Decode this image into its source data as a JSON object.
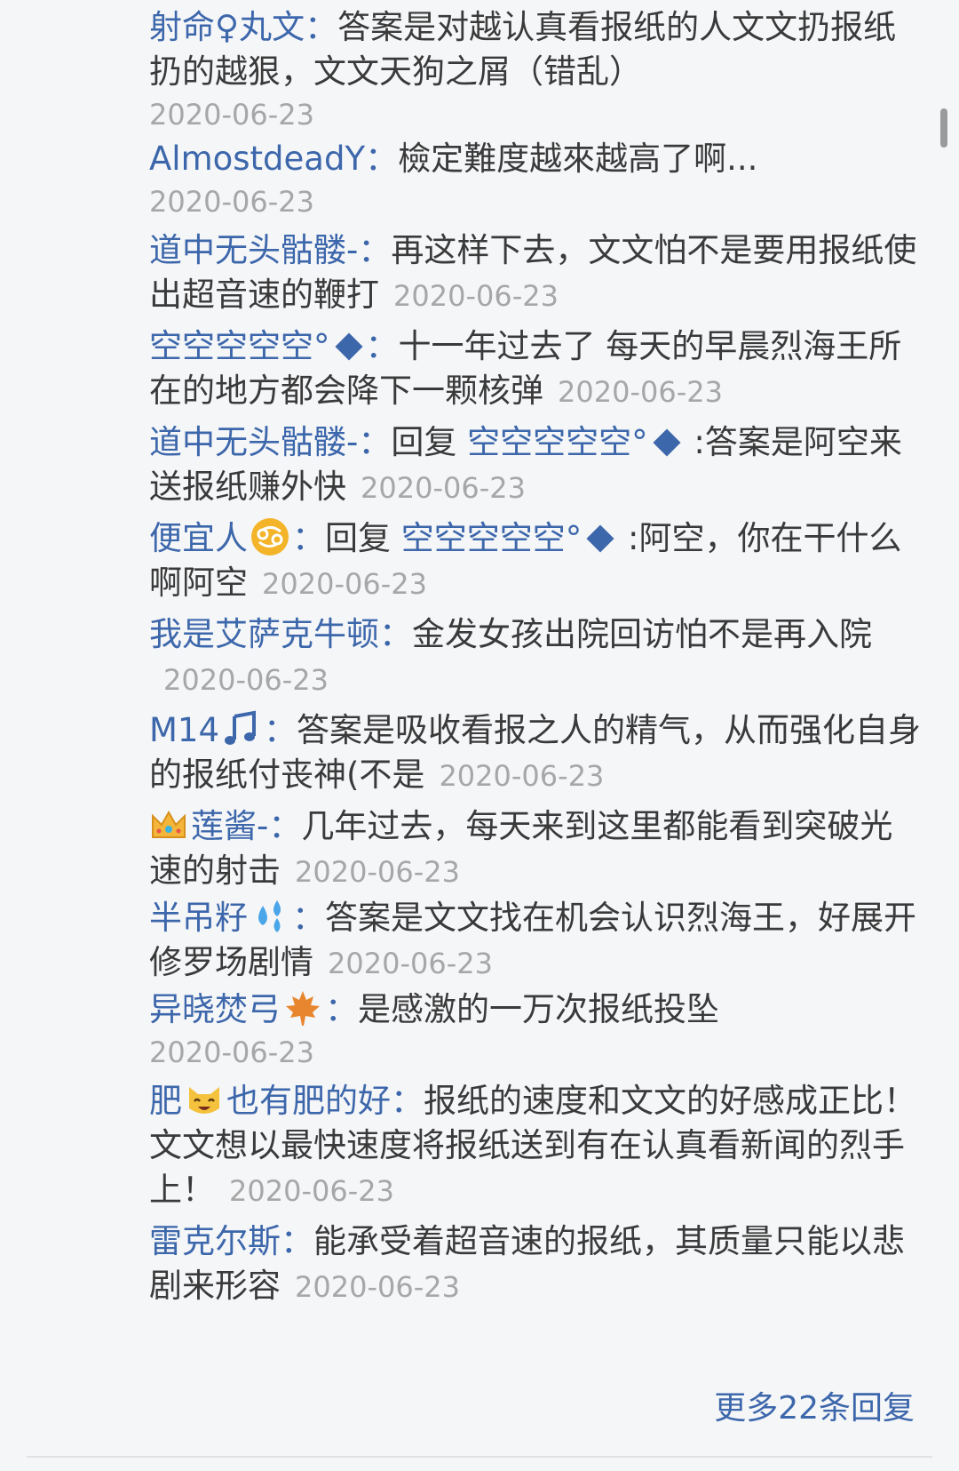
{
  "replies": [
    {
      "user": "射命♀丸文",
      "text": "答案是对越认真看报纸的人文文扔报纸扔的越狠，文文天狗之屑（错乱）",
      "date": "2020-06-23"
    },
    {
      "user": "AlmostdeadY",
      "text": "檢定難度越來越高了啊...",
      "date": "2020-06-23"
    },
    {
      "user": "道中无头骷髅-",
      "text": "再这样下去，文文怕不是要用报纸使出超音速的鞭打",
      "date": "2020-06-23"
    },
    {
      "user": "空空空空空°",
      "text": "十一年过去了 每天的早晨烈海王所在的地方都会降下一颗核弹",
      "date": "2020-06-23"
    },
    {
      "user": "道中无头骷髅-",
      "reply_word": "回复",
      "mention": "空空空空空°",
      "text": ":答案是阿空来送报纸赚外快",
      "date": "2020-06-23"
    },
    {
      "user": "便宜人",
      "reply_word": "回复",
      "mention": "空空空空空°",
      "text": ":阿空，你在干什么啊阿空",
      "date": "2020-06-23"
    },
    {
      "user": "我是艾萨克牛顿",
      "text": "金发女孩出院回访怕不是再入院",
      "date": "2020-06-23"
    },
    {
      "user": "M14",
      "text": "答案是吸收看报之人的精气，从而强化自身的报纸付丧神(不是",
      "date": "2020-06-23"
    },
    {
      "user": "莲酱-",
      "text": "几年过去，每天来到这里都能看到突破光速的射击",
      "date": "2020-06-23"
    },
    {
      "user": "半吊籽",
      "text": "答案是文文找在机会认识烈海王，好展开修罗场剧情",
      "date": "2020-06-23"
    },
    {
      "user": "异晓焚弓",
      "text": "是感激的一万次报纸投坠",
      "date": "2020-06-23"
    },
    {
      "user": "肥",
      "user_tail": "也有肥的好",
      "text": "报纸的速度和文文的好感成正比！文文想以最快速度将报纸送到有在认真看新闻的烈手上！",
      "date": "2020-06-23"
    },
    {
      "user": "雷克尔斯",
      "text": "能承受着超音速的报纸，其质量只能以悲剧来形容",
      "date": "2020-06-23"
    }
  ],
  "separator": "：",
  "more_replies_label": "更多22条回复",
  "colors": {
    "username": "#3d67ab",
    "text": "#3a3a3a",
    "date": "#a7a7a7",
    "background": "#f5f6f8"
  },
  "icons": [
    "diamond-icon",
    "cancer-zodiac-icon",
    "music-note-icon",
    "crown-icon",
    "sweat-droplets-icon",
    "maple-leaf-icon",
    "cat-face-icon"
  ]
}
